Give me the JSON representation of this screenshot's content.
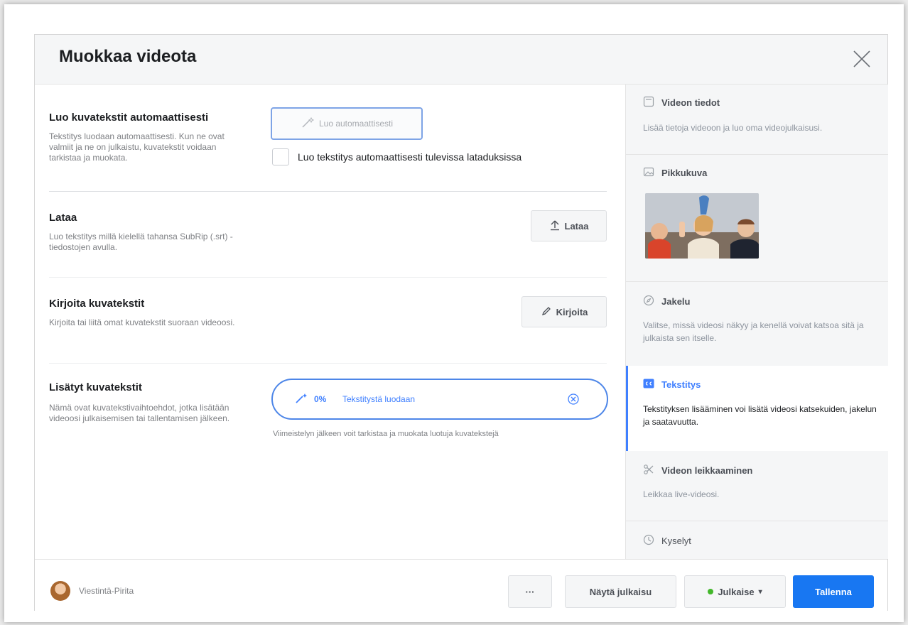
{
  "dialog": {
    "title": "Muokkaa videota"
  },
  "sections": {
    "auto": {
      "title": "Luo kuvatekstit automaattisesti",
      "description": "Tekstitys luodaan automaattisesti. Kun ne ovat valmiit ja ne on julkaistu, kuvatekstit voidaan tarkistaa ja muokata.",
      "button_label": "Luo automaattisesti",
      "checkbox_label": "Luo tekstitys automaattisesti tulevissa lataduksissa",
      "checkbox_checked": false
    },
    "upload": {
      "title": "Lataa",
      "description": "Luo tekstitys millä kielellä tahansa SubRip (.srt) -tiedostojen avulla.",
      "button_label": "Lataa"
    },
    "write": {
      "title": "Kirjoita kuvatekstit",
      "description": "Kirjoita tai liitä omat kuvatekstit suoraan videoosi.",
      "button_label": "Kirjoita"
    },
    "added": {
      "title": "Lisätyt kuvatekstit",
      "description": "Nämä ovat kuvatekstivaihtoehdot, jotka lisätään videoosi julkaisemisen tai tallentamisen jälkeen.",
      "progress_percent": "0%",
      "progress_value": 0,
      "progress_text": "Tekstitystä luodaan",
      "note": "Viimeistelyn jälkeen voit tarkistaa ja muokata luotuja kuvatekstejä"
    }
  },
  "sidebar": {
    "video_info": {
      "title": "Videon tiedot",
      "description": "Lisää tietoja videoon ja luo oma videojulkaisusi."
    },
    "thumbnail": {
      "title": "Pikkukuva"
    },
    "distribution": {
      "title": "Jakelu",
      "description": "Valitse, missä videosi näkyy ja kenellä voivat katsoa sitä ja julkaista sen itselle."
    },
    "subtitles": {
      "title": "Tekstitys",
      "description": "Tekstityksen lisääminen voi lisätä videosi katsekuiden, jakelun ja saatavuutta."
    },
    "trimming": {
      "title": "Videon leikkaaminen",
      "description": "Leikkaa live-videosi."
    },
    "polls": {
      "title": "Kyselyt"
    }
  },
  "footer": {
    "page_name": "Viestintä-Pirita",
    "more_label": "···",
    "preview_label": "Näytä julkaisu",
    "publish_label": "Julkaise",
    "publish_caret": "▾",
    "save_label": "Tallenna"
  },
  "colors": {
    "accent": "#1877f2",
    "link_blue": "#4080ff",
    "status_green": "#42b72a"
  }
}
